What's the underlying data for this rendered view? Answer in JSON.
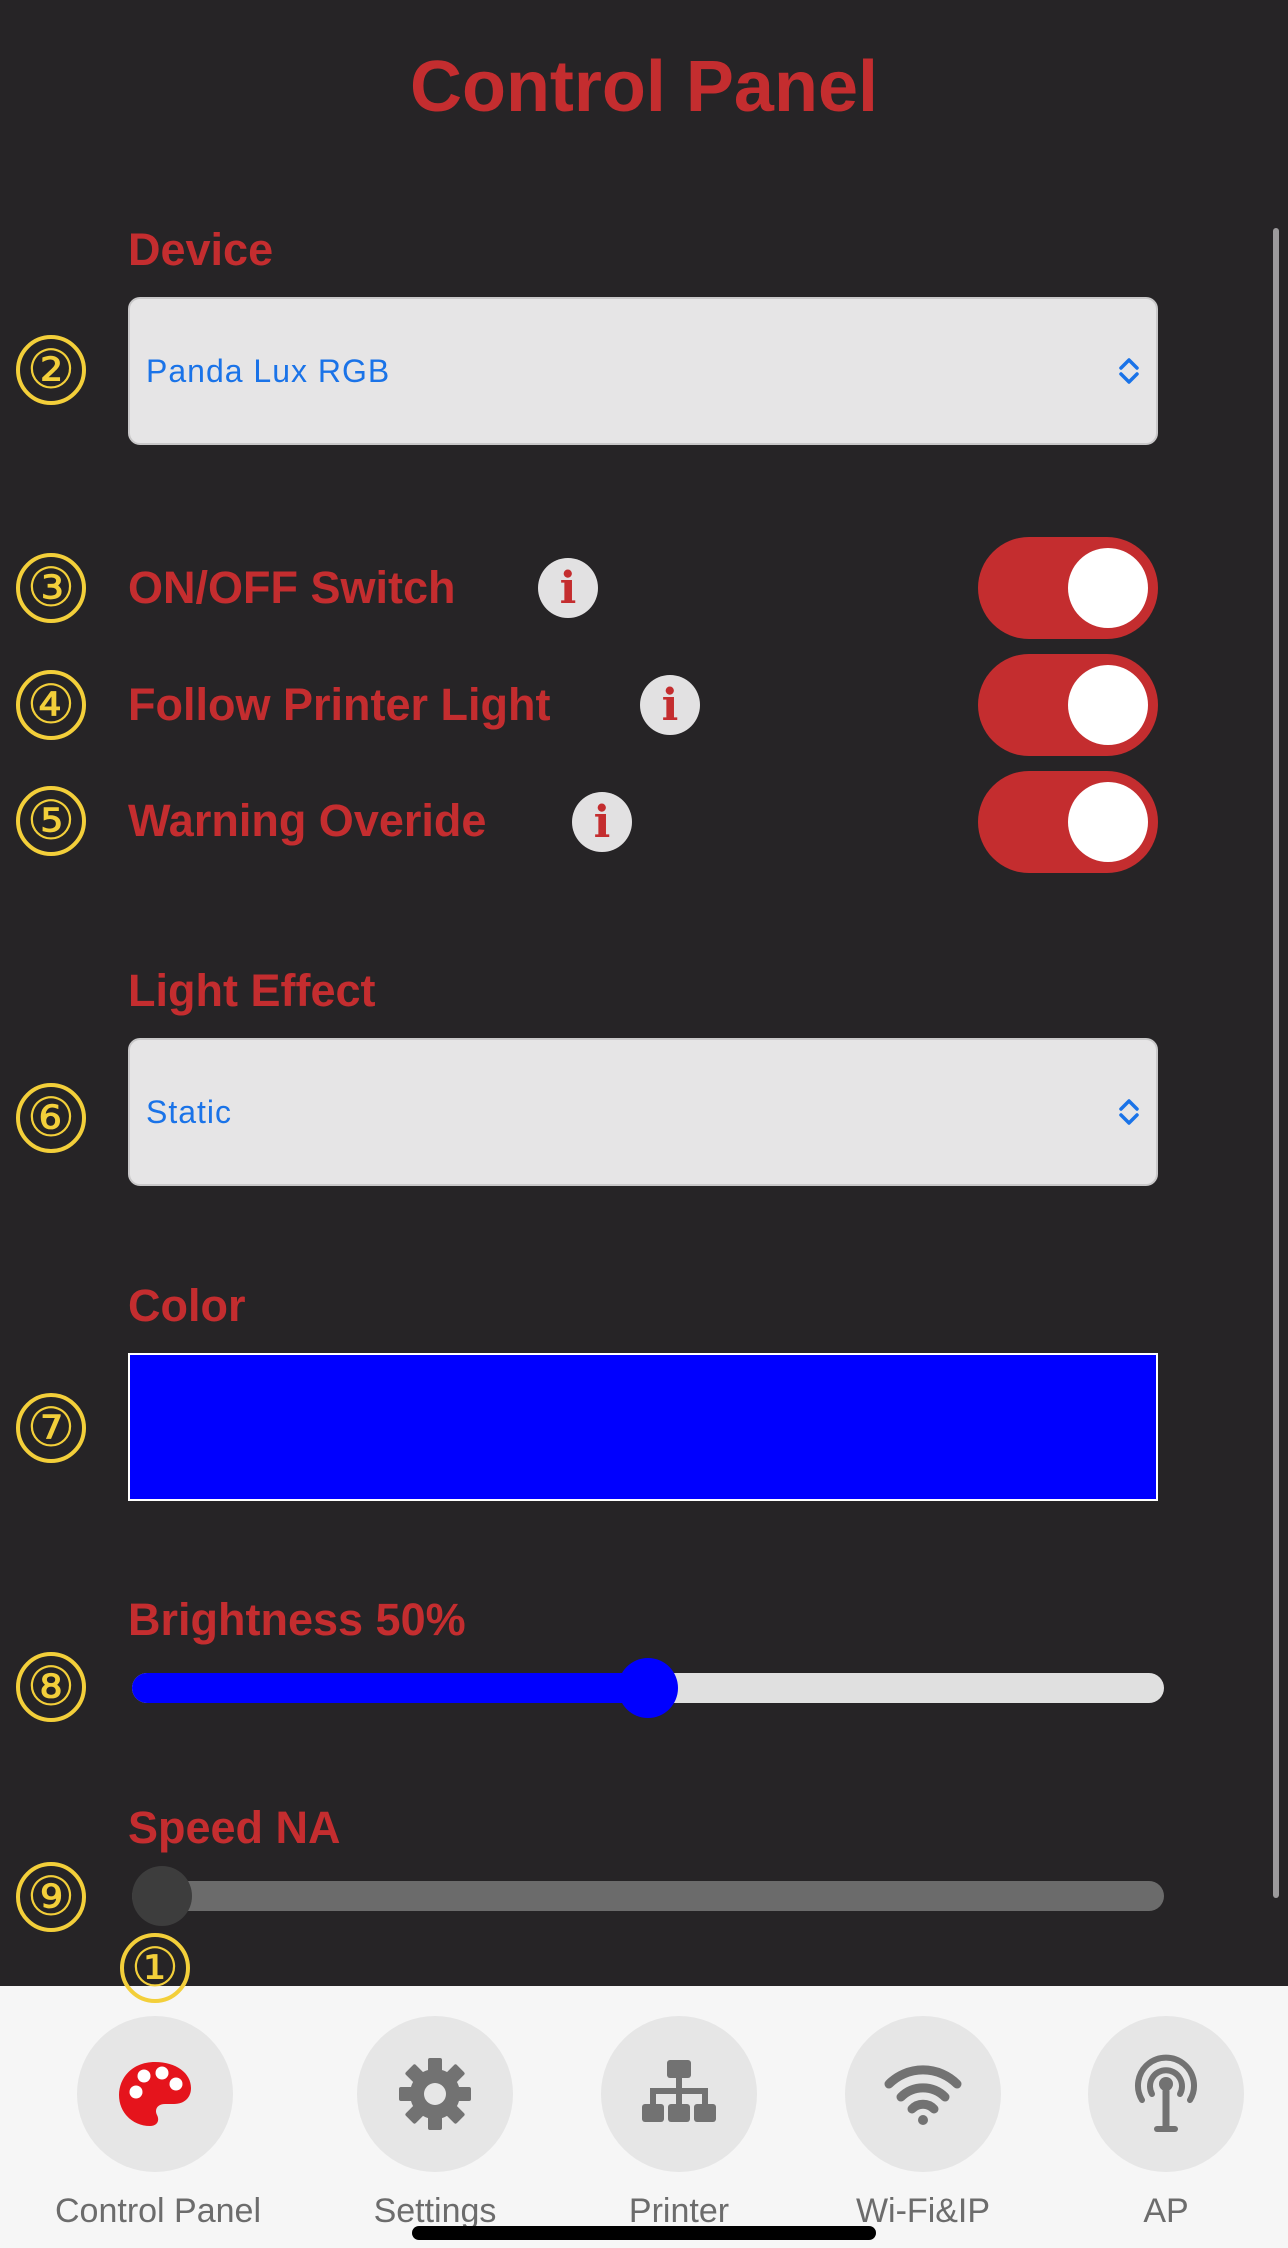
{
  "header": {
    "title": "Control Panel"
  },
  "markers": [
    "①",
    "②",
    "③",
    "④",
    "⑤",
    "⑥",
    "⑦",
    "⑧",
    "⑨"
  ],
  "device": {
    "label": "Device",
    "value": "Panda Lux RGB"
  },
  "switches": [
    {
      "label": "ON/OFF Switch",
      "info": "i",
      "on": true
    },
    {
      "label": "Follow Printer Light",
      "info": "i",
      "on": true
    },
    {
      "label": "Warning Overide",
      "info": "i",
      "on": true
    }
  ],
  "light_effect": {
    "label": "Light Effect",
    "value": "Static"
  },
  "color": {
    "label": "Color",
    "value": "#0000ff"
  },
  "brightness": {
    "label": "Brightness 50%",
    "percent": 50,
    "fill_color": "#0000ff"
  },
  "speed": {
    "label": "Speed NA",
    "percent": 0
  },
  "tabs": [
    {
      "label": "Control Panel",
      "icon": "palette-icon",
      "active": true
    },
    {
      "label": "Settings",
      "icon": "gear-icon",
      "active": false
    },
    {
      "label": "Printer",
      "icon": "network-tree-icon",
      "active": false
    },
    {
      "label": "Wi-Fi&IP",
      "icon": "wifi-icon",
      "active": false
    },
    {
      "label": "AP",
      "icon": "broadcast-antenna-icon",
      "active": false
    }
  ],
  "colors": {
    "accent": "#c42d2f",
    "marker": "#f3cf3a",
    "active_tab_icon": "#e5141c",
    "inactive_tab_icon": "#727272"
  }
}
